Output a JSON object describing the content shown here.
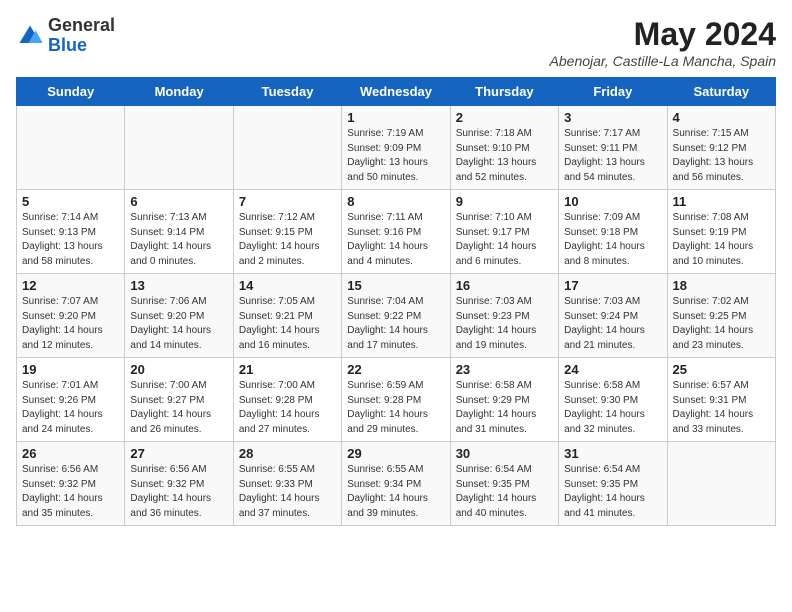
{
  "header": {
    "logo_general": "General",
    "logo_blue": "Blue",
    "month_year": "May 2024",
    "location": "Abenojar, Castille-La Mancha, Spain"
  },
  "weekdays": [
    "Sunday",
    "Monday",
    "Tuesday",
    "Wednesday",
    "Thursday",
    "Friday",
    "Saturday"
  ],
  "weeks": [
    [
      {
        "day": "",
        "info": ""
      },
      {
        "day": "",
        "info": ""
      },
      {
        "day": "",
        "info": ""
      },
      {
        "day": "1",
        "info": "Sunrise: 7:19 AM\nSunset: 9:09 PM\nDaylight: 13 hours\nand 50 minutes."
      },
      {
        "day": "2",
        "info": "Sunrise: 7:18 AM\nSunset: 9:10 PM\nDaylight: 13 hours\nand 52 minutes."
      },
      {
        "day": "3",
        "info": "Sunrise: 7:17 AM\nSunset: 9:11 PM\nDaylight: 13 hours\nand 54 minutes."
      },
      {
        "day": "4",
        "info": "Sunrise: 7:15 AM\nSunset: 9:12 PM\nDaylight: 13 hours\nand 56 minutes."
      }
    ],
    [
      {
        "day": "5",
        "info": "Sunrise: 7:14 AM\nSunset: 9:13 PM\nDaylight: 13 hours\nand 58 minutes."
      },
      {
        "day": "6",
        "info": "Sunrise: 7:13 AM\nSunset: 9:14 PM\nDaylight: 14 hours\nand 0 minutes."
      },
      {
        "day": "7",
        "info": "Sunrise: 7:12 AM\nSunset: 9:15 PM\nDaylight: 14 hours\nand 2 minutes."
      },
      {
        "day": "8",
        "info": "Sunrise: 7:11 AM\nSunset: 9:16 PM\nDaylight: 14 hours\nand 4 minutes."
      },
      {
        "day": "9",
        "info": "Sunrise: 7:10 AM\nSunset: 9:17 PM\nDaylight: 14 hours\nand 6 minutes."
      },
      {
        "day": "10",
        "info": "Sunrise: 7:09 AM\nSunset: 9:18 PM\nDaylight: 14 hours\nand 8 minutes."
      },
      {
        "day": "11",
        "info": "Sunrise: 7:08 AM\nSunset: 9:19 PM\nDaylight: 14 hours\nand 10 minutes."
      }
    ],
    [
      {
        "day": "12",
        "info": "Sunrise: 7:07 AM\nSunset: 9:20 PM\nDaylight: 14 hours\nand 12 minutes."
      },
      {
        "day": "13",
        "info": "Sunrise: 7:06 AM\nSunset: 9:20 PM\nDaylight: 14 hours\nand 14 minutes."
      },
      {
        "day": "14",
        "info": "Sunrise: 7:05 AM\nSunset: 9:21 PM\nDaylight: 14 hours\nand 16 minutes."
      },
      {
        "day": "15",
        "info": "Sunrise: 7:04 AM\nSunset: 9:22 PM\nDaylight: 14 hours\nand 17 minutes."
      },
      {
        "day": "16",
        "info": "Sunrise: 7:03 AM\nSunset: 9:23 PM\nDaylight: 14 hours\nand 19 minutes."
      },
      {
        "day": "17",
        "info": "Sunrise: 7:03 AM\nSunset: 9:24 PM\nDaylight: 14 hours\nand 21 minutes."
      },
      {
        "day": "18",
        "info": "Sunrise: 7:02 AM\nSunset: 9:25 PM\nDaylight: 14 hours\nand 23 minutes."
      }
    ],
    [
      {
        "day": "19",
        "info": "Sunrise: 7:01 AM\nSunset: 9:26 PM\nDaylight: 14 hours\nand 24 minutes."
      },
      {
        "day": "20",
        "info": "Sunrise: 7:00 AM\nSunset: 9:27 PM\nDaylight: 14 hours\nand 26 minutes."
      },
      {
        "day": "21",
        "info": "Sunrise: 7:00 AM\nSunset: 9:28 PM\nDaylight: 14 hours\nand 27 minutes."
      },
      {
        "day": "22",
        "info": "Sunrise: 6:59 AM\nSunset: 9:28 PM\nDaylight: 14 hours\nand 29 minutes."
      },
      {
        "day": "23",
        "info": "Sunrise: 6:58 AM\nSunset: 9:29 PM\nDaylight: 14 hours\nand 31 minutes."
      },
      {
        "day": "24",
        "info": "Sunrise: 6:58 AM\nSunset: 9:30 PM\nDaylight: 14 hours\nand 32 minutes."
      },
      {
        "day": "25",
        "info": "Sunrise: 6:57 AM\nSunset: 9:31 PM\nDaylight: 14 hours\nand 33 minutes."
      }
    ],
    [
      {
        "day": "26",
        "info": "Sunrise: 6:56 AM\nSunset: 9:32 PM\nDaylight: 14 hours\nand 35 minutes."
      },
      {
        "day": "27",
        "info": "Sunrise: 6:56 AM\nSunset: 9:32 PM\nDaylight: 14 hours\nand 36 minutes."
      },
      {
        "day": "28",
        "info": "Sunrise: 6:55 AM\nSunset: 9:33 PM\nDaylight: 14 hours\nand 37 minutes."
      },
      {
        "day": "29",
        "info": "Sunrise: 6:55 AM\nSunset: 9:34 PM\nDaylight: 14 hours\nand 39 minutes."
      },
      {
        "day": "30",
        "info": "Sunrise: 6:54 AM\nSunset: 9:35 PM\nDaylight: 14 hours\nand 40 minutes."
      },
      {
        "day": "31",
        "info": "Sunrise: 6:54 AM\nSunset: 9:35 PM\nDaylight: 14 hours\nand 41 minutes."
      },
      {
        "day": "",
        "info": ""
      }
    ]
  ]
}
